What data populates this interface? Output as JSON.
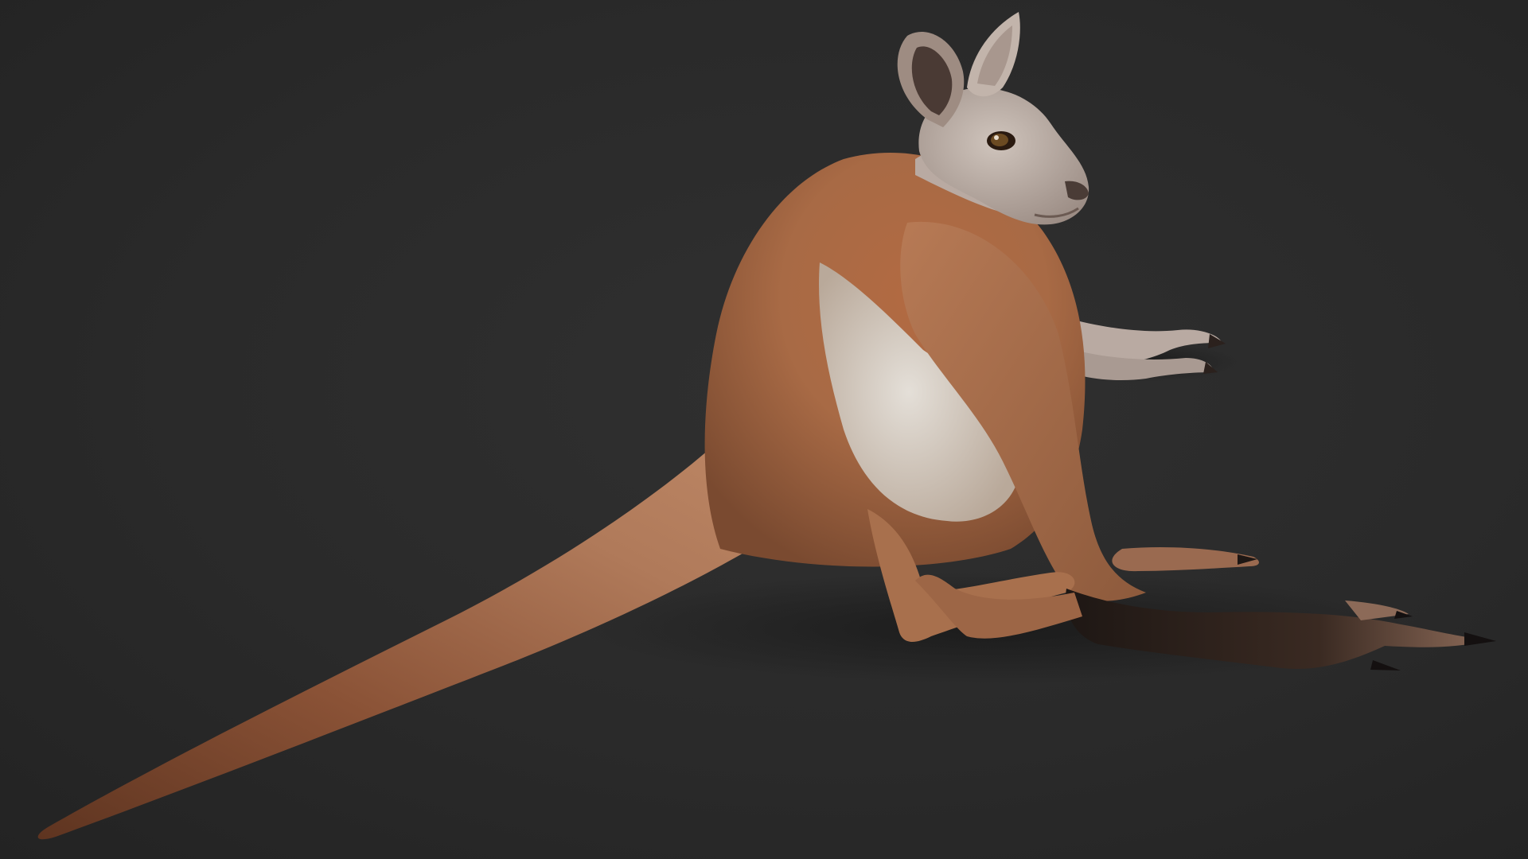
{
  "scene": {
    "subject": "kangaroo-render",
    "colors": {
      "background": "#2a2a2a",
      "fur_red": "#a86a45",
      "fur_light": "#c9967a",
      "fur_dark": "#6e3e24",
      "belly": "#d8d2ca",
      "head": "#bdb0a8",
      "paw_dark": "#2b211d",
      "eye": "#6b4a22"
    }
  }
}
